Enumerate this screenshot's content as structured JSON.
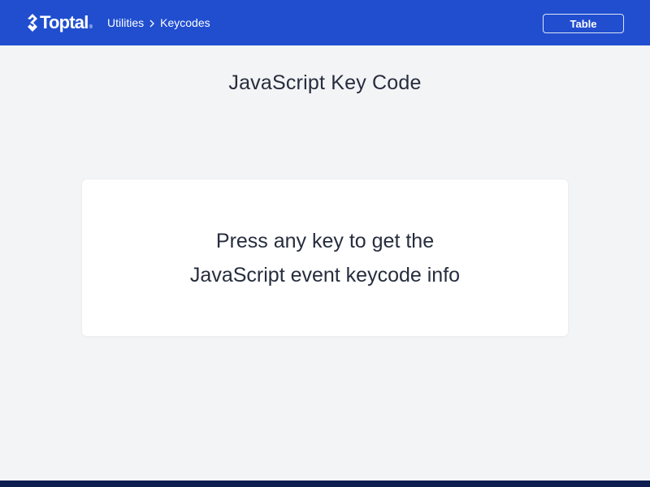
{
  "header": {
    "logo_text": "Toptal",
    "logo_reg": "®",
    "breadcrumb": [
      {
        "label": "Utilities"
      },
      {
        "label": "Keycodes"
      }
    ],
    "table_button_label": "Table"
  },
  "main": {
    "title": "JavaScript Key Code",
    "prompt_line_1": "Press any key to get the",
    "prompt_line_2": "JavaScript event keycode info"
  },
  "colors": {
    "header_bg": "#204ecf",
    "page_bg": "#f3f4f6",
    "footer_bg": "#0e1d50",
    "text": "#262d3d"
  },
  "icons": {
    "logo": "toptal-logo-mark-icon",
    "breadcrumb_separator": "chevron-right-icon"
  }
}
